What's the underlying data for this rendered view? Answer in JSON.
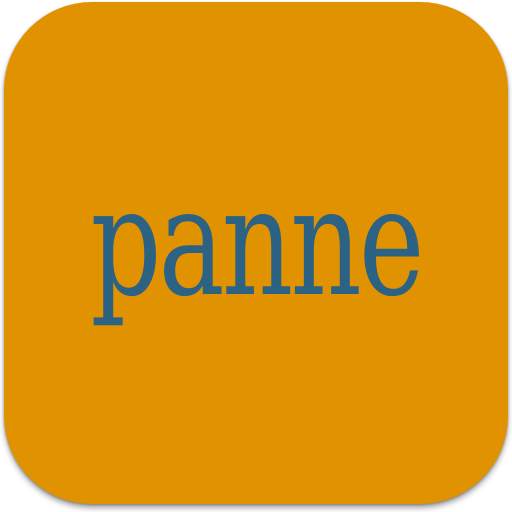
{
  "app_icon": {
    "label": "panne",
    "background_color": "#e19200",
    "text_color": "#2c6284"
  }
}
